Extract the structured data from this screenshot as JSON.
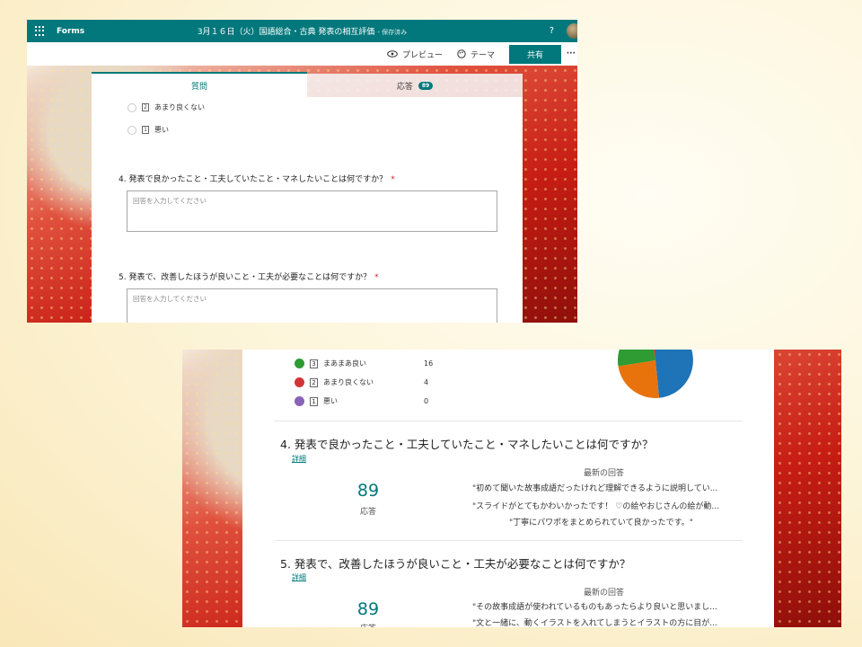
{
  "forms_editor": {
    "brand": "Forms",
    "title": "3月１６日（火）国語総合・古典 発表の相互評価",
    "save_status": "- 保存済み",
    "help": "?",
    "commands": {
      "preview": "プレビュー",
      "theme": "テーマ",
      "share": "共有",
      "more": "···"
    },
    "tabs": {
      "questions": "質問",
      "responses": "応答",
      "responses_count": "89"
    },
    "options": [
      {
        "num": "2",
        "label": "あまり良くない"
      },
      {
        "num": "1",
        "label": "悪い"
      }
    ],
    "questions": [
      {
        "title": "4. 発表で良かったこと・工夫していたこと・マネしたいことは何ですか？",
        "required": "*",
        "placeholder": "回答を入力してください"
      },
      {
        "title": "5. 発表で、改善したほうが良いこと・工夫が必要なことは何ですか？",
        "required": "*",
        "placeholder": "回答を入力してください"
      }
    ]
  },
  "responses_view": {
    "legend": [
      {
        "num": "3",
        "label": "まあまあ良い",
        "count": "16",
        "color": "#2e9b33"
      },
      {
        "num": "2",
        "label": "あまり良くない",
        "count": "4",
        "color": "#d13438"
      },
      {
        "num": "1",
        "label": "悪い",
        "count": "0",
        "color": "#8764b8"
      }
    ],
    "pie_colors": {
      "blue": "#1f73b7",
      "orange": "#e8730c",
      "green": "#2e9b33",
      "red": "#d13438"
    },
    "questions": [
      {
        "title": "4.  発表で良かったこと・工夫していたこと・マネしたいことは何ですか？",
        "details": "詳細",
        "count": "89",
        "count_label": "応答",
        "latest_header": "最新の回答",
        "responses": [
          "\"初めて聞いた故事成語だったけれど理解できるように説明してい...",
          "\"スライドがとてもかわいかったです！ ♡の絵やおじさんの絵が動...",
          "\"丁寧にパワポをまとめられていて良かったです。\""
        ]
      },
      {
        "title": "5.  発表で、改善したほうが良いこと・工夫が必要なことは何ですか？",
        "details": "詳細",
        "count": "89",
        "count_label": "応答",
        "latest_header": "最新の回答",
        "responses": [
          "\"その故事成語が使われているものもあったらより良いと思いまし...",
          "\"文と一緒に、動くイラストを入れてしまうとイラストの方に目が..."
        ]
      }
    ]
  }
}
